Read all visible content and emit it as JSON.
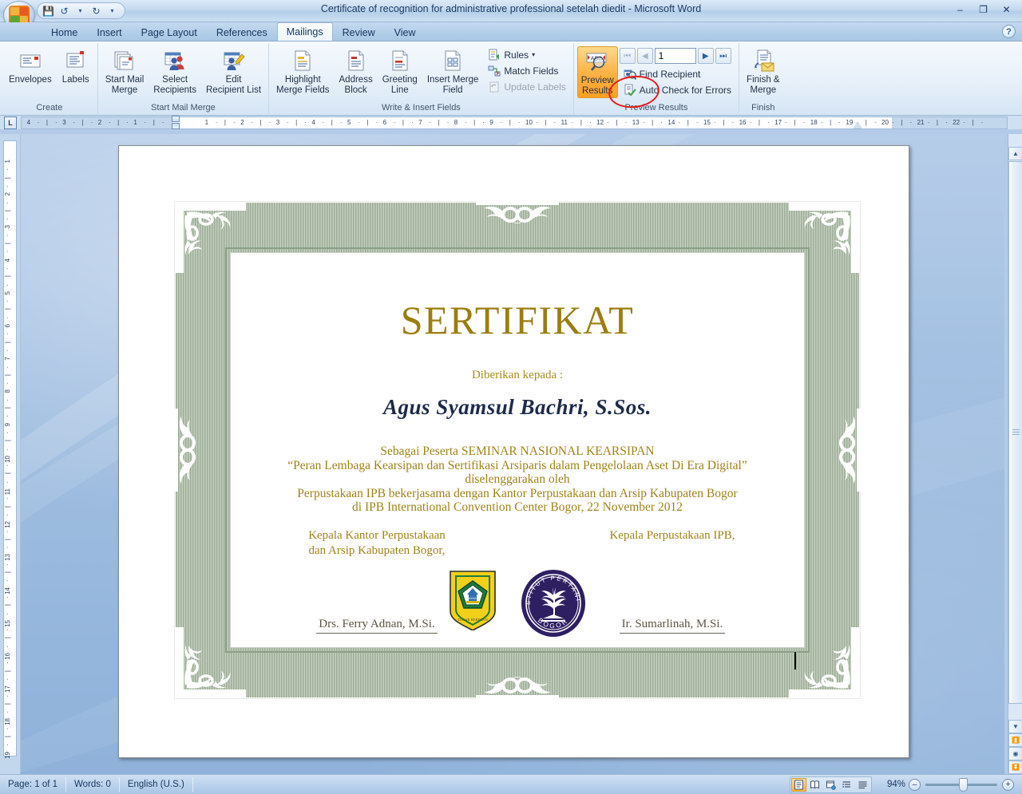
{
  "window": {
    "title": "Certificate of recognition for administrative professional setelah diedit - Microsoft Word",
    "minimize": "–",
    "maximize": "❐",
    "close": "✕",
    "help": "?"
  },
  "quick_access": {
    "save": "💾",
    "undo": "↺",
    "undo_dropdown": "▾",
    "redo": "↻",
    "customize": "▾"
  },
  "tabs": [
    {
      "label": "Home",
      "active": false
    },
    {
      "label": "Insert",
      "active": false
    },
    {
      "label": "Page Layout",
      "active": false
    },
    {
      "label": "References",
      "active": false
    },
    {
      "label": "Mailings",
      "active": true
    },
    {
      "label": "Review",
      "active": false
    },
    {
      "label": "View",
      "active": false
    }
  ],
  "ribbon": {
    "groups": [
      {
        "name": "Create",
        "label": "Create",
        "buttons": [
          {
            "label": "Envelopes",
            "icon": "envelope-icon"
          },
          {
            "label": "Labels",
            "icon": "labels-icon"
          }
        ]
      },
      {
        "name": "Start Mail Merge",
        "label": "Start Mail Merge",
        "buttons": [
          {
            "label": "Start Mail\nMerge",
            "icon": "start-mail-merge-icon",
            "dropdown": "▾"
          },
          {
            "label": "Select\nRecipients",
            "icon": "select-recipients-icon",
            "dropdown": "▾"
          },
          {
            "label": "Edit\nRecipient List",
            "icon": "edit-recipient-list-icon",
            "dropdown": ""
          }
        ]
      },
      {
        "name": "Write & Insert Fields",
        "label": "Write & Insert Fields",
        "buttons": [
          {
            "label": "Highlight\nMerge Fields",
            "icon": "highlight-merge-fields-icon",
            "dropdown": ""
          },
          {
            "label": "Address\nBlock",
            "icon": "address-block-icon",
            "dropdown": ""
          },
          {
            "label": "Greeting\nLine",
            "icon": "greeting-line-icon",
            "dropdown": ""
          },
          {
            "label": "Insert Merge\nField",
            "icon": "insert-merge-field-icon",
            "dropdown": "▾"
          }
        ],
        "small_buttons": [
          {
            "label": "Rules",
            "icon": "rules-icon",
            "dropdown": "▾",
            "disabled": false
          },
          {
            "label": "Match Fields",
            "icon": "match-fields-icon",
            "dropdown": "",
            "disabled": false
          },
          {
            "label": "Update Labels",
            "icon": "update-labels-icon",
            "dropdown": "",
            "disabled": true
          }
        ]
      },
      {
        "name": "Preview Results",
        "label": "Preview Results",
        "buttons": [
          {
            "label": "Preview\nResults",
            "icon": "preview-results-icon",
            "active": true
          }
        ],
        "record_nav": {
          "first": "⏮",
          "previous": "◀",
          "value": "1",
          "next": "▶",
          "last": "⏭"
        },
        "small_buttons": [
          {
            "label": "Find Recipient",
            "icon": "find-recipient-icon",
            "disabled": false
          },
          {
            "label": "Auto Check for Errors",
            "icon": "auto-check-errors-icon",
            "disabled": false
          }
        ]
      },
      {
        "name": "Finish",
        "label": "Finish",
        "buttons": [
          {
            "label": "Finish &\nMerge",
            "icon": "finish-merge-icon",
            "dropdown": "▾"
          }
        ]
      }
    ]
  },
  "rulers": {
    "tab_selector": "L",
    "horizontal_max": 26,
    "vertical_max": 19
  },
  "certificate": {
    "title": "SERTIFIKAT",
    "given_to": "Diberikan kepada :",
    "recipient_name": "Agus Syamsul Bachri, S.Sos.",
    "body_lines": [
      "Sebagai Peserta SEMINAR NASIONAL KEARSIPAN",
      "“Peran Lembaga Kearsipan dan Sertifikasi Arsiparis dalam Pengelolaan Aset Di Era Digital”",
      "diselenggarakan oleh",
      "Perpustakaan IPB bekerjasama dengan Kantor Perpustakaan dan Arsip Kabupaten Bogor",
      "di IPB International Convention Center Bogor,  22 November 2012"
    ],
    "signature_left": {
      "title_line1": "Kepala Kantor Perpustakaan",
      "title_line2": "dan Arsip Kabupaten Bogor,",
      "name": "Drs. Ferry Adnan, M.Si."
    },
    "signature_right": {
      "title_line1": "Kepala Perpustakaan IPB,",
      "title_line2": "",
      "name": "Ir. Sumarlinah, M.Si."
    },
    "seals": [
      {
        "name": "bogor-regency-seal",
        "motto": "TEGAR BERIMAN"
      },
      {
        "name": "ipb-seal",
        "text_top": "INSTITUT PERTANIAN",
        "text_bottom": "BOGOR"
      }
    ],
    "colors": {
      "gold": "#9b7d10",
      "body_gold": "#a08318",
      "name_navy": "#1d2b4a",
      "border_green": "#9dae97",
      "seal_yellow": "#f2d01a",
      "seal_purple": "#2e1f63"
    }
  },
  "annotation": {
    "shape": "red-ellipse",
    "color": "#e81c1c",
    "target": "record-number-box"
  },
  "statusbar": {
    "page": "Page: 1 of 1",
    "words": "Words: 0",
    "language": "English (U.S.)",
    "view_buttons": [
      {
        "name": "print-layout-view",
        "glyph": "▤",
        "active": true
      },
      {
        "name": "full-screen-reading-view",
        "glyph": "▥",
        "active": false
      },
      {
        "name": "web-layout-view",
        "glyph": "▦",
        "active": false
      },
      {
        "name": "outline-view",
        "glyph": "▤",
        "active": false
      },
      {
        "name": "draft-view",
        "glyph": "▤",
        "active": false
      }
    ],
    "zoom": "94%",
    "zoom_out": "–",
    "zoom_in": "+"
  }
}
